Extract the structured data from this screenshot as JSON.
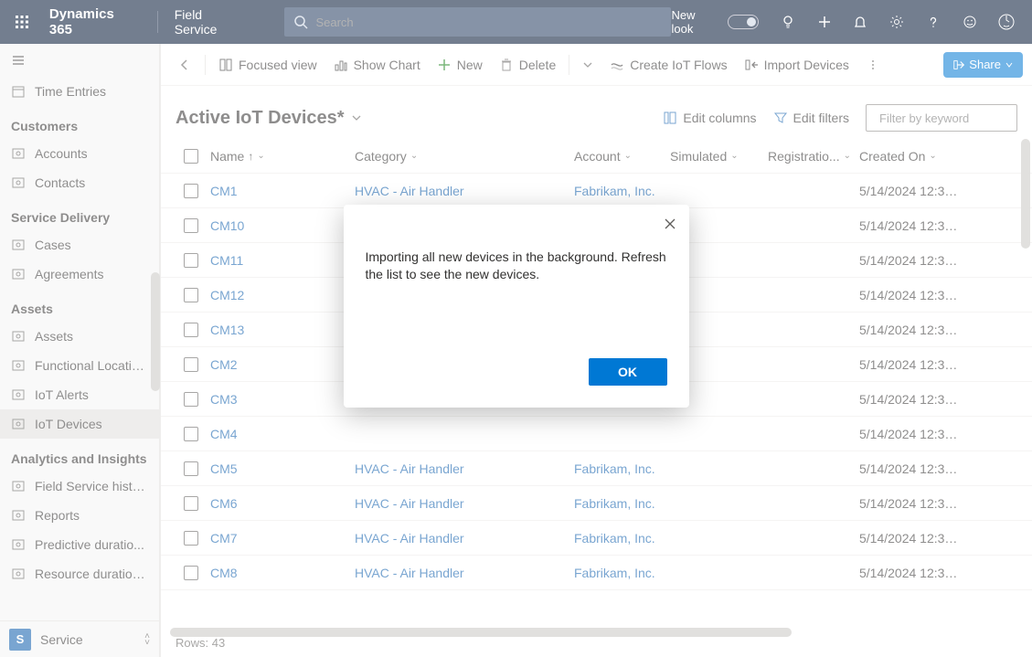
{
  "topbar": {
    "brand": "Dynamics 365",
    "app": "Field Service",
    "search_placeholder": "Search",
    "new_look": "New look"
  },
  "sidebar": {
    "top_item": "Time Entries",
    "groups": [
      {
        "header": "Customers",
        "items": [
          {
            "label": "Accounts",
            "icon": "building"
          },
          {
            "label": "Contacts",
            "icon": "person"
          }
        ]
      },
      {
        "header": "Service Delivery",
        "items": [
          {
            "label": "Cases",
            "icon": "case"
          },
          {
            "label": "Agreements",
            "icon": "doc"
          }
        ]
      },
      {
        "header": "Assets",
        "items": [
          {
            "label": "Assets",
            "icon": "asset"
          },
          {
            "label": "Functional Locatio...",
            "icon": "location"
          },
          {
            "label": "IoT Alerts",
            "icon": "alert"
          },
          {
            "label": "IoT Devices",
            "icon": "device",
            "selected": true
          }
        ]
      },
      {
        "header": "Analytics and Insights",
        "items": [
          {
            "label": "Field Service histo...",
            "icon": "report"
          },
          {
            "label": "Reports",
            "icon": "report"
          },
          {
            "label": "Predictive duratio...",
            "icon": "report"
          },
          {
            "label": "Resource duration...",
            "icon": "report"
          }
        ]
      }
    ],
    "area_badge": "S",
    "area_label": "Service"
  },
  "commands": {
    "focused_view": "Focused view",
    "show_chart": "Show Chart",
    "new": "New",
    "delete": "Delete",
    "create_flows": "Create IoT Flows",
    "import": "Import Devices",
    "share": "Share"
  },
  "view": {
    "title": "Active IoT Devices*",
    "edit_columns": "Edit columns",
    "edit_filters": "Edit filters",
    "filter_placeholder": "Filter by keyword"
  },
  "columns": {
    "name": "Name",
    "category": "Category",
    "account": "Account",
    "simulated": "Simulated",
    "registration": "Registratio...",
    "created": "Created On"
  },
  "rows": [
    {
      "name": "CM1",
      "category": "HVAC - Air Handler",
      "account": "Fabrikam, Inc.",
      "created": "5/14/2024 12:37 ..."
    },
    {
      "name": "CM10",
      "category": "",
      "account": "",
      "created": "5/14/2024 12:37 ..."
    },
    {
      "name": "CM11",
      "category": "",
      "account": "",
      "created": "5/14/2024 12:37 ..."
    },
    {
      "name": "CM12",
      "category": "",
      "account": "",
      "created": "5/14/2024 12:37 ..."
    },
    {
      "name": "CM13",
      "category": "",
      "account": "",
      "created": "5/14/2024 12:37 ..."
    },
    {
      "name": "CM2",
      "category": "",
      "account": "",
      "created": "5/14/2024 12:37 ..."
    },
    {
      "name": "CM3",
      "category": "",
      "account": "",
      "created": "5/14/2024 12:37 ..."
    },
    {
      "name": "CM4",
      "category": "",
      "account": "",
      "created": "5/14/2024 12:37 ..."
    },
    {
      "name": "CM5",
      "category": "HVAC - Air Handler",
      "account": "Fabrikam, Inc.",
      "created": "5/14/2024 12:37 ..."
    },
    {
      "name": "CM6",
      "category": "HVAC - Air Handler",
      "account": "Fabrikam, Inc.",
      "created": "5/14/2024 12:37 ..."
    },
    {
      "name": "CM7",
      "category": "HVAC - Air Handler",
      "account": "Fabrikam, Inc.",
      "created": "5/14/2024 12:37 ..."
    },
    {
      "name": "CM8",
      "category": "HVAC - Air Handler",
      "account": "Fabrikam, Inc.",
      "created": "5/14/2024 12:37 ..."
    }
  ],
  "status": {
    "rows": "Rows: 43"
  },
  "dialog": {
    "message": "Importing all new devices in the background. Refresh the list to see the new devices.",
    "ok": "OK"
  }
}
